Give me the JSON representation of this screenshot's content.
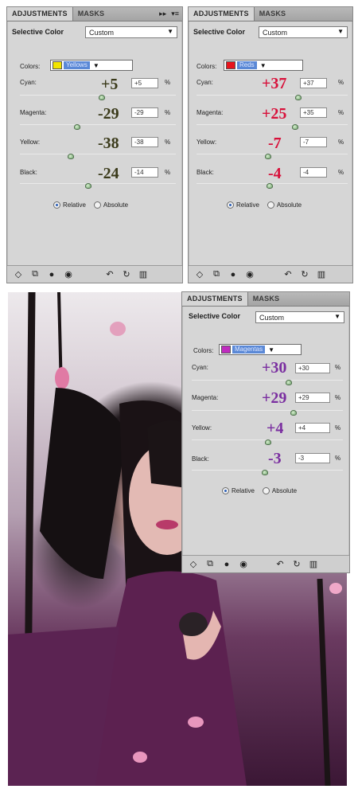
{
  "panels": [
    {
      "tab_active": "ADJUSTMENTS",
      "tab_inactive": "MASKS",
      "title": "Selective Color",
      "preset": "Custom",
      "colors_label": "Colors:",
      "color_name": "Yellows",
      "swatch_color": "#f2e400",
      "value_color": "#3a3a1a",
      "sliders": [
        {
          "label": "Cyan:",
          "big": "+5",
          "field": "+5"
        },
        {
          "label": "Magenta:",
          "big": "-29",
          "field": "-29"
        },
        {
          "label": "Yellow:",
          "big": "-38",
          "field": "-38"
        },
        {
          "label": "Black:",
          "big": "-24",
          "field": "-14"
        }
      ],
      "percent": "%",
      "relative": "Relative",
      "absolute": "Absolute"
    },
    {
      "tab_active": "ADJUSTMENTS",
      "tab_inactive": "MASKS",
      "title": "Selective Color",
      "preset": "Custom",
      "colors_label": "Colors:",
      "color_name": "Reds",
      "swatch_color": "#e8141c",
      "value_color": "#d8103a",
      "sliders": [
        {
          "label": "Cyan:",
          "big": "+37",
          "field": "+37"
        },
        {
          "label": "Magenta:",
          "big": "+25",
          "field": "+35"
        },
        {
          "label": "Yellow:",
          "big": "-7",
          "field": "-7"
        },
        {
          "label": "Black:",
          "big": "-4",
          "field": "-4"
        }
      ],
      "percent": "%",
      "relative": "Relative",
      "absolute": "Absolute"
    },
    {
      "tab_active": "ADJUSTMENTS",
      "tab_inactive": "MASKS",
      "title": "Selective Color",
      "preset": "Custom",
      "colors_label": "Colors:",
      "color_name": "Magentas",
      "swatch_color": "#c02cc0",
      "value_color": "#7a2ea0",
      "sliders": [
        {
          "label": "Cyan:",
          "big": "+30",
          "field": "+30"
        },
        {
          "label": "Magenta:",
          "big": "+29",
          "field": "+29"
        },
        {
          "label": "Yellow:",
          "big": "+4",
          "field": "+4"
        },
        {
          "label": "Black:",
          "big": "-3",
          "field": "-3"
        }
      ],
      "percent": "%",
      "relative": "Relative",
      "absolute": "Absolute"
    }
  ],
  "footer_icons": [
    "layer-icon",
    "link-icon",
    "mask-icon",
    "eye-icon",
    "reset-icon",
    "redo-icon",
    "trash-icon"
  ]
}
